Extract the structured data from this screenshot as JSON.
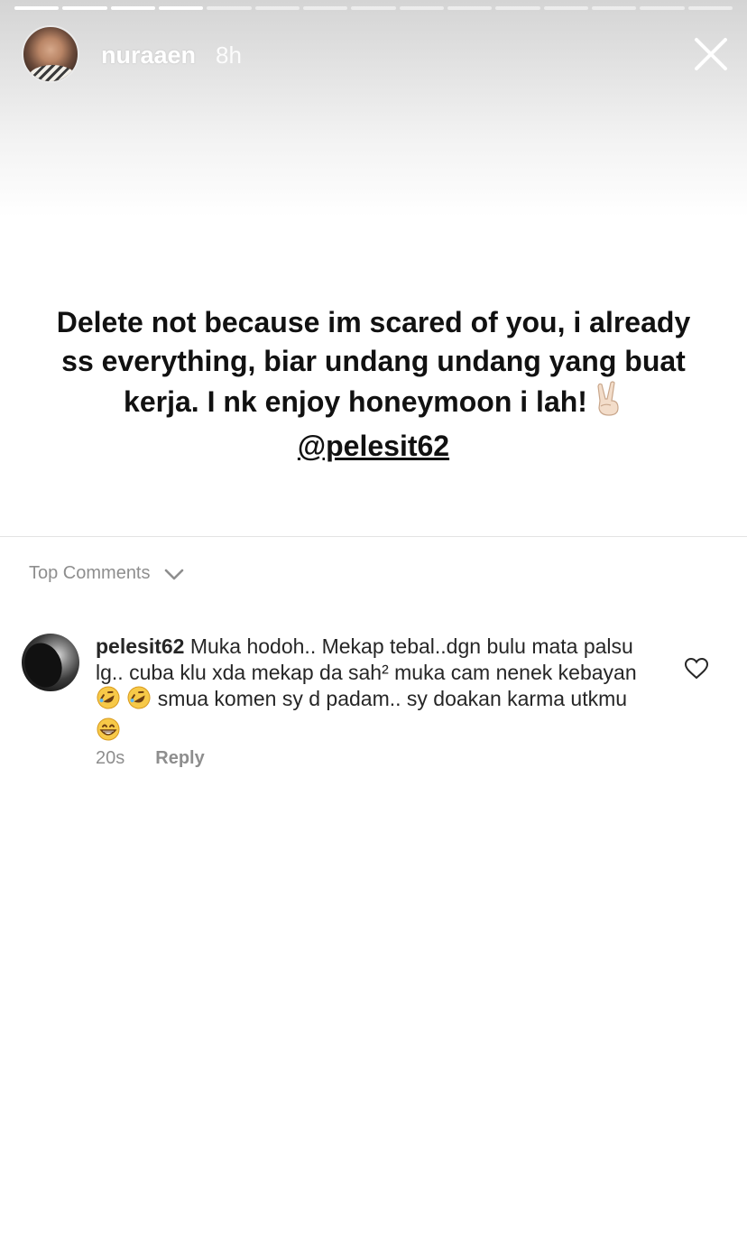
{
  "story": {
    "progress": {
      "total_segments": 15,
      "completed_segments": 4
    },
    "username": "nuraaen",
    "posted_ago": "8h",
    "caption_lines": [
      "Delete not because im scared of you,  i already",
      "ss everything, biar undang undang yang buat",
      "kerja. I nk enjoy honeymoon i lah!"
    ],
    "mention": "@pelesit62",
    "icons": {
      "close": "close-icon",
      "peace_emoji": "victory-hand-emoji"
    }
  },
  "comments_section": {
    "header_label": "Top Comments",
    "header_icon": "chevron-down-icon",
    "comments": [
      {
        "username": "pelesit62",
        "text_part1": "Muka hodoh.. Mekap tebal..dgn bulu mata palsu lg.. cuba klu xda mekap da sah² muka cam nenek kebayan",
        "text_part2": "smua komen sy d padam.. sy doakan karma utkmu",
        "emojis": [
          "rolling-on-floor-laughing-emoji",
          "rolling-on-floor-laughing-emoji",
          "grinning-face-emoji"
        ],
        "time_ago": "20s",
        "reply_label": "Reply",
        "like_icon": "heart-outline-icon"
      }
    ]
  },
  "colors": {
    "text_primary": "#262626",
    "text_secondary": "#8e8e8e",
    "caption_text": "#111111",
    "divider": "#e3e3e3"
  }
}
